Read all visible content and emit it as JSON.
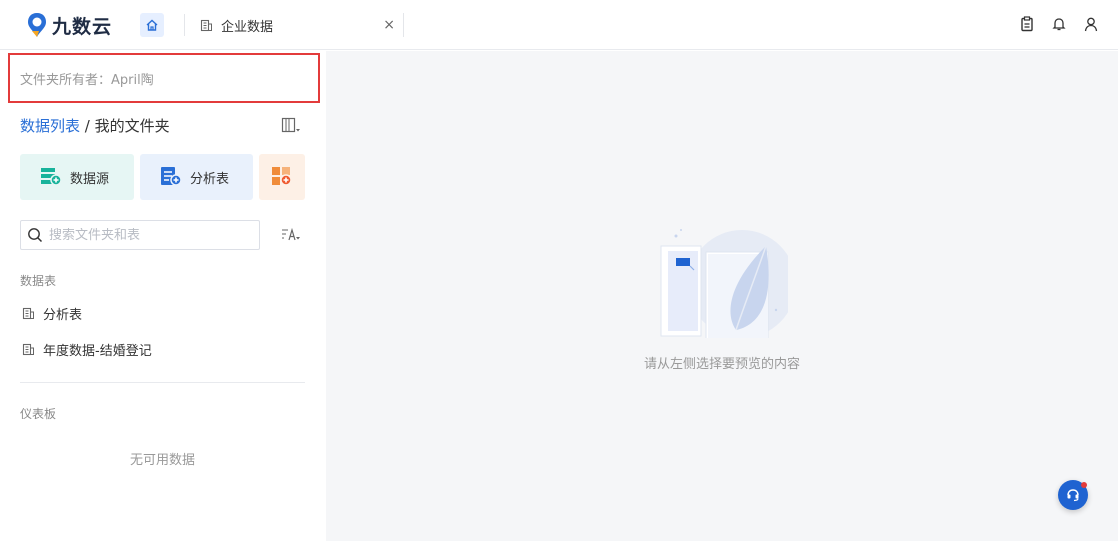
{
  "header": {
    "logo_text": "九数云",
    "tab_label": "企业数据",
    "tab_close": "×"
  },
  "sidebar": {
    "owner_label": "文件夹所有者：April陶",
    "breadcrumb_root": "数据列表",
    "breadcrumb_sep": " / ",
    "breadcrumb_current": "我的文件夹",
    "quick_actions": [
      {
        "label": "数据源",
        "icon": "datasource-add-icon"
      },
      {
        "label": "分析表",
        "icon": "analysis-table-add-icon"
      },
      {
        "label": "",
        "icon": "dashboard-add-icon"
      }
    ],
    "search_placeholder": "搜索文件夹和表",
    "section_tables": "数据表",
    "tables": [
      {
        "label": "分析表"
      },
      {
        "label": "年度数据-结婚登记"
      }
    ],
    "section_dashboards": "仪表板",
    "dashboards_empty": "无可用数据"
  },
  "main": {
    "empty_hint": "请从左侧选择要预览的内容"
  },
  "colors": {
    "accent": "#2a6fd6",
    "highlight_border": "#e33b3b",
    "chat_button": "#1f63d1"
  }
}
